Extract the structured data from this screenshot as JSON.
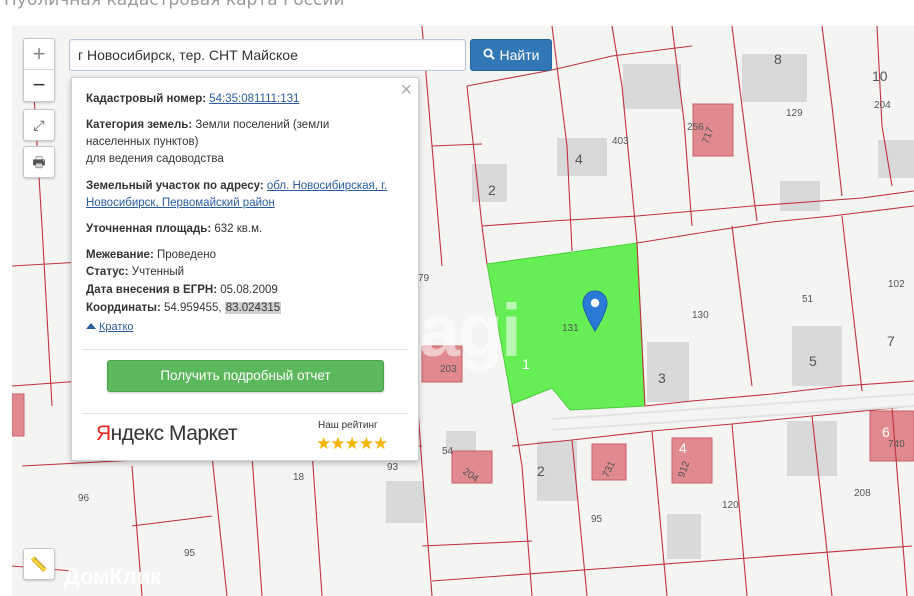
{
  "page": {
    "title": "Публичная кадастровая карта России"
  },
  "search": {
    "value": "г Новосибирск, тер. СНТ Майское",
    "button_label": "Найти"
  },
  "controls": {
    "zoom_in": "+",
    "zoom_out": "−",
    "fullscreen": "⤢",
    "print": "🖶",
    "ruler": "📏"
  },
  "info": {
    "close": "×",
    "cadastral_label": "Кадастровый номер:",
    "cadastral_value": "54:35:081111:131",
    "category_label": "Категория земель:",
    "category_value_1": "Земли поселений (земли",
    "category_value_2": "населенных пунктов)",
    "category_value_3": "для ведения садоводства",
    "address_label": "Земельный участок по адресу:",
    "address_value_1": "обл. Новосибирская, г.",
    "address_value_2": "Новосибирск, Первомайский район",
    "area_label": "Уточненная площадь:",
    "area_value": "632 кв.м.",
    "survey_label": "Межевание:",
    "survey_value": "Проведено",
    "status_label": "Статус:",
    "status_value": "Учтенный",
    "date_label": "Дата внесения в ЕГРН:",
    "date_value": "05.08.2009",
    "coords_label": "Координаты:",
    "coords_lat": "54.959455,",
    "coords_lon": "83.024315",
    "toggle_label": "Кратко",
    "report_button": "Получить подробный отчет",
    "ad_brand_1": "Я",
    "ad_brand_2": "ндекс Маркет",
    "rating_label": "Наш рейтинг",
    "stars": "★★★★★"
  },
  "map": {
    "watermark": "etagi",
    "watermark2": "ДомКлик",
    "labels": {
      "n8": "8",
      "n10": "10",
      "n204": "204",
      "n129": "129",
      "n256": "256",
      "n717": "717",
      "n403": "403",
      "n4": "4",
      "n2": "2",
      "n79": "79",
      "n131": "131",
      "n1": "1",
      "n130": "130",
      "n51": "51",
      "n102": "102",
      "n5": "5",
      "n7": "7",
      "n203": "203",
      "n3": "3",
      "n6": "6",
      "n740": "740",
      "n54": "54",
      "n93": "93",
      "n204b": "204",
      "n2b": "2",
      "n731": "731",
      "n4b": "4",
      "n912": "912",
      "n120": "120",
      "n208": "208",
      "n18": "18",
      "n96": "96",
      "n95": "95",
      "n95b": "95"
    }
  },
  "colors": {
    "selected_parcel": "#66ee55",
    "parcel_border": "#c0323c",
    "building_gray": "#d9d9d9",
    "building_red": "#e08a8f",
    "marker": "#2b7bd6",
    "search_button": "#3277b6",
    "report_button": "#5cb85c"
  }
}
